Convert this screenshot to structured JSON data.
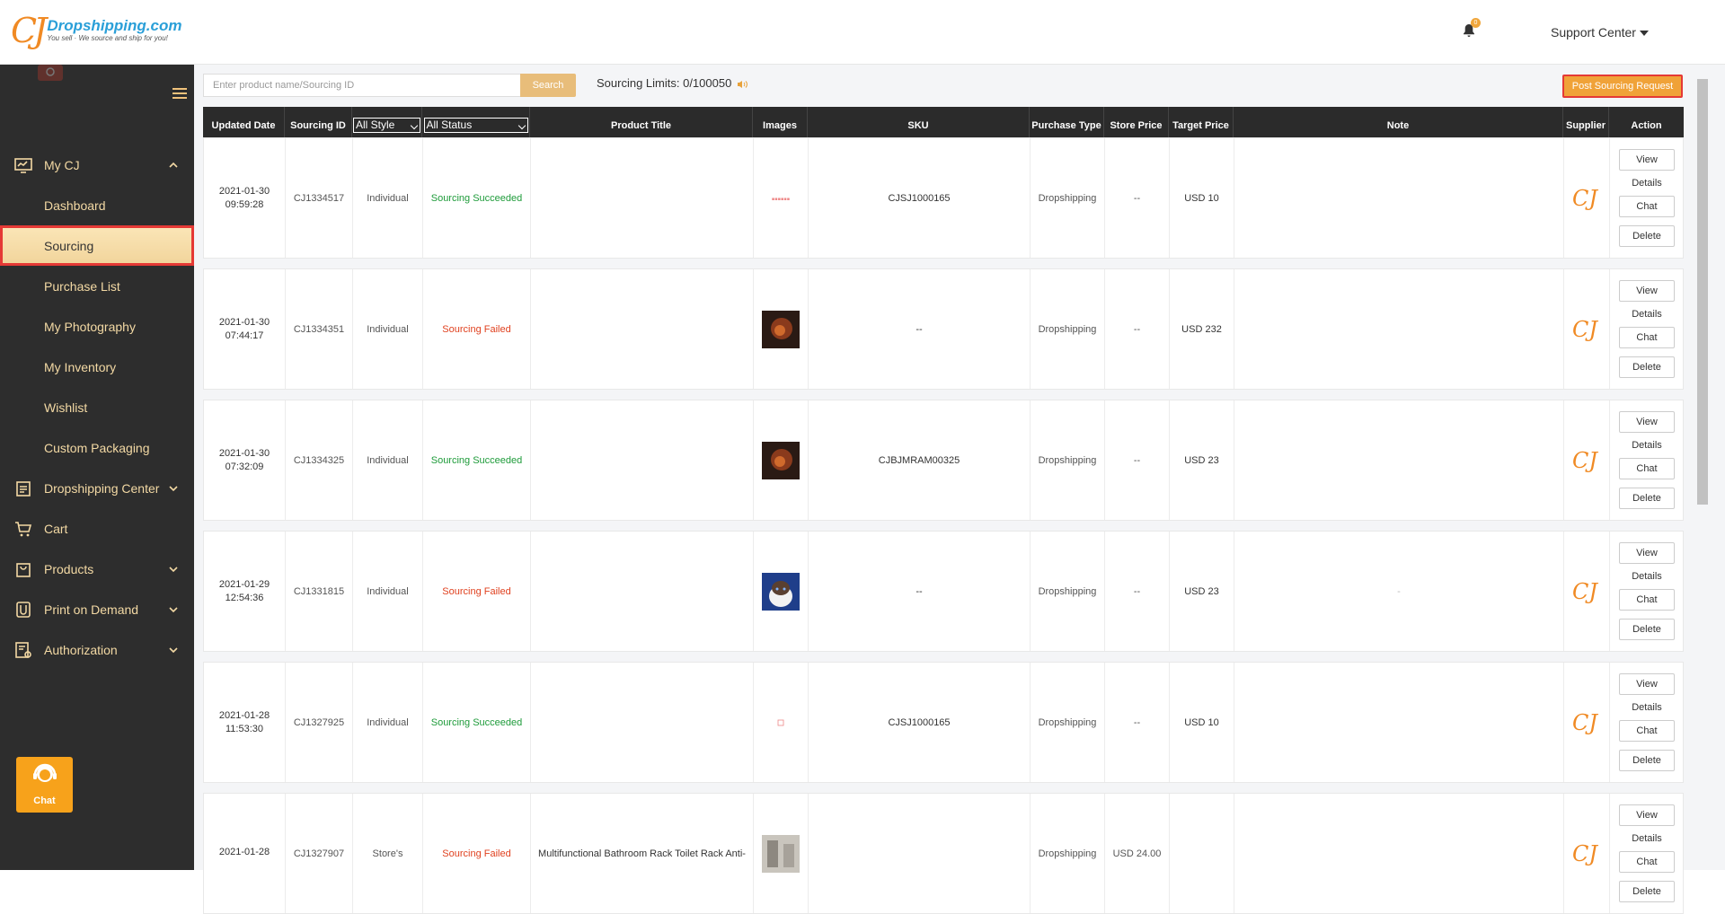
{
  "header": {
    "brand": "Dropshipping.com",
    "slogan": "You sell · We source and ship for you!",
    "notification_count": "0",
    "support_label": "Support Center"
  },
  "sidebar": {
    "sections": [
      {
        "label": "My CJ"
      },
      {
        "label": "Dropshipping Center"
      },
      {
        "label": "Cart"
      },
      {
        "label": "Products"
      },
      {
        "label": "Print on Demand"
      },
      {
        "label": "Authorization"
      }
    ],
    "subitems": [
      {
        "label": "Dashboard"
      },
      {
        "label": "Sourcing"
      },
      {
        "label": "Purchase List"
      },
      {
        "label": "My Photography"
      },
      {
        "label": "My Inventory"
      },
      {
        "label": "Wishlist"
      },
      {
        "label": "Custom Packaging"
      }
    ],
    "chat_label": "Chat"
  },
  "toolbar": {
    "search_placeholder": "Enter product name/Sourcing ID",
    "search_label": "Search",
    "limits_label": "Sourcing Limits: 0/100050",
    "post_label": "Post Sourcing Request"
  },
  "table": {
    "headers": {
      "updated": "Updated Date",
      "sid": "Sourcing ID",
      "style": "All Style",
      "status": "All Status",
      "title": "Product Title",
      "images": "Images",
      "sku": "SKU",
      "ptype": "Purchase Type",
      "sprice": "Store Price",
      "tprice": "Target Price",
      "note": "Note",
      "supplier": "Supplier",
      "action": "Action"
    },
    "actions": {
      "view": "View",
      "details": "Details",
      "chat": "Chat",
      "delete": "Delete"
    },
    "rows": [
      {
        "date": "2021-01-30",
        "time": "09:59:28",
        "id": "CJ1334517",
        "style": "Individual",
        "status": "Sourcing Succeeded",
        "title": "",
        "sku": "CJSJ1000165",
        "ptype": "Dropshipping",
        "sprice": "--",
        "tprice": "USD 10",
        "note": ""
      },
      {
        "date": "2021-01-30",
        "time": "07:44:17",
        "id": "CJ1334351",
        "style": "Individual",
        "status": "Sourcing Failed",
        "title": "",
        "sku": "--",
        "ptype": "Dropshipping",
        "sprice": "--",
        "tprice": "USD 232",
        "note": ""
      },
      {
        "date": "2021-01-30",
        "time": "07:32:09",
        "id": "CJ1334325",
        "style": "Individual",
        "status": "Sourcing Succeeded",
        "title": "",
        "sku": "CJBJMRAM00325",
        "ptype": "Dropshipping",
        "sprice": "--",
        "tprice": "USD 23",
        "note": ""
      },
      {
        "date": "2021-01-29",
        "time": "12:54:36",
        "id": "CJ1331815",
        "style": "Individual",
        "status": "Sourcing Failed",
        "title": "",
        "sku": "--",
        "ptype": "Dropshipping",
        "sprice": "--",
        "tprice": "USD 23",
        "note": "-"
      },
      {
        "date": "2021-01-28",
        "time": "11:53:30",
        "id": "CJ1327925",
        "style": "Individual",
        "status": "Sourcing Succeeded",
        "title": "",
        "sku": "CJSJ1000165",
        "ptype": "Dropshipping",
        "sprice": "--",
        "tprice": "USD 10",
        "note": ""
      },
      {
        "date": "2021-01-28",
        "time": "",
        "id": "CJ1327907",
        "style": "Store's",
        "status": "Sourcing Failed",
        "title": "Multifunctional Bathroom Rack Toilet Rack Anti-",
        "sku": "",
        "ptype": "Dropshipping",
        "sprice": "USD 24.00",
        "tprice": "",
        "note": ""
      }
    ]
  },
  "colors": {
    "accent": "#f0a238",
    "sidebar": "#2d2d2d",
    "success": "#1e9b3a",
    "failed": "#e0411f"
  }
}
